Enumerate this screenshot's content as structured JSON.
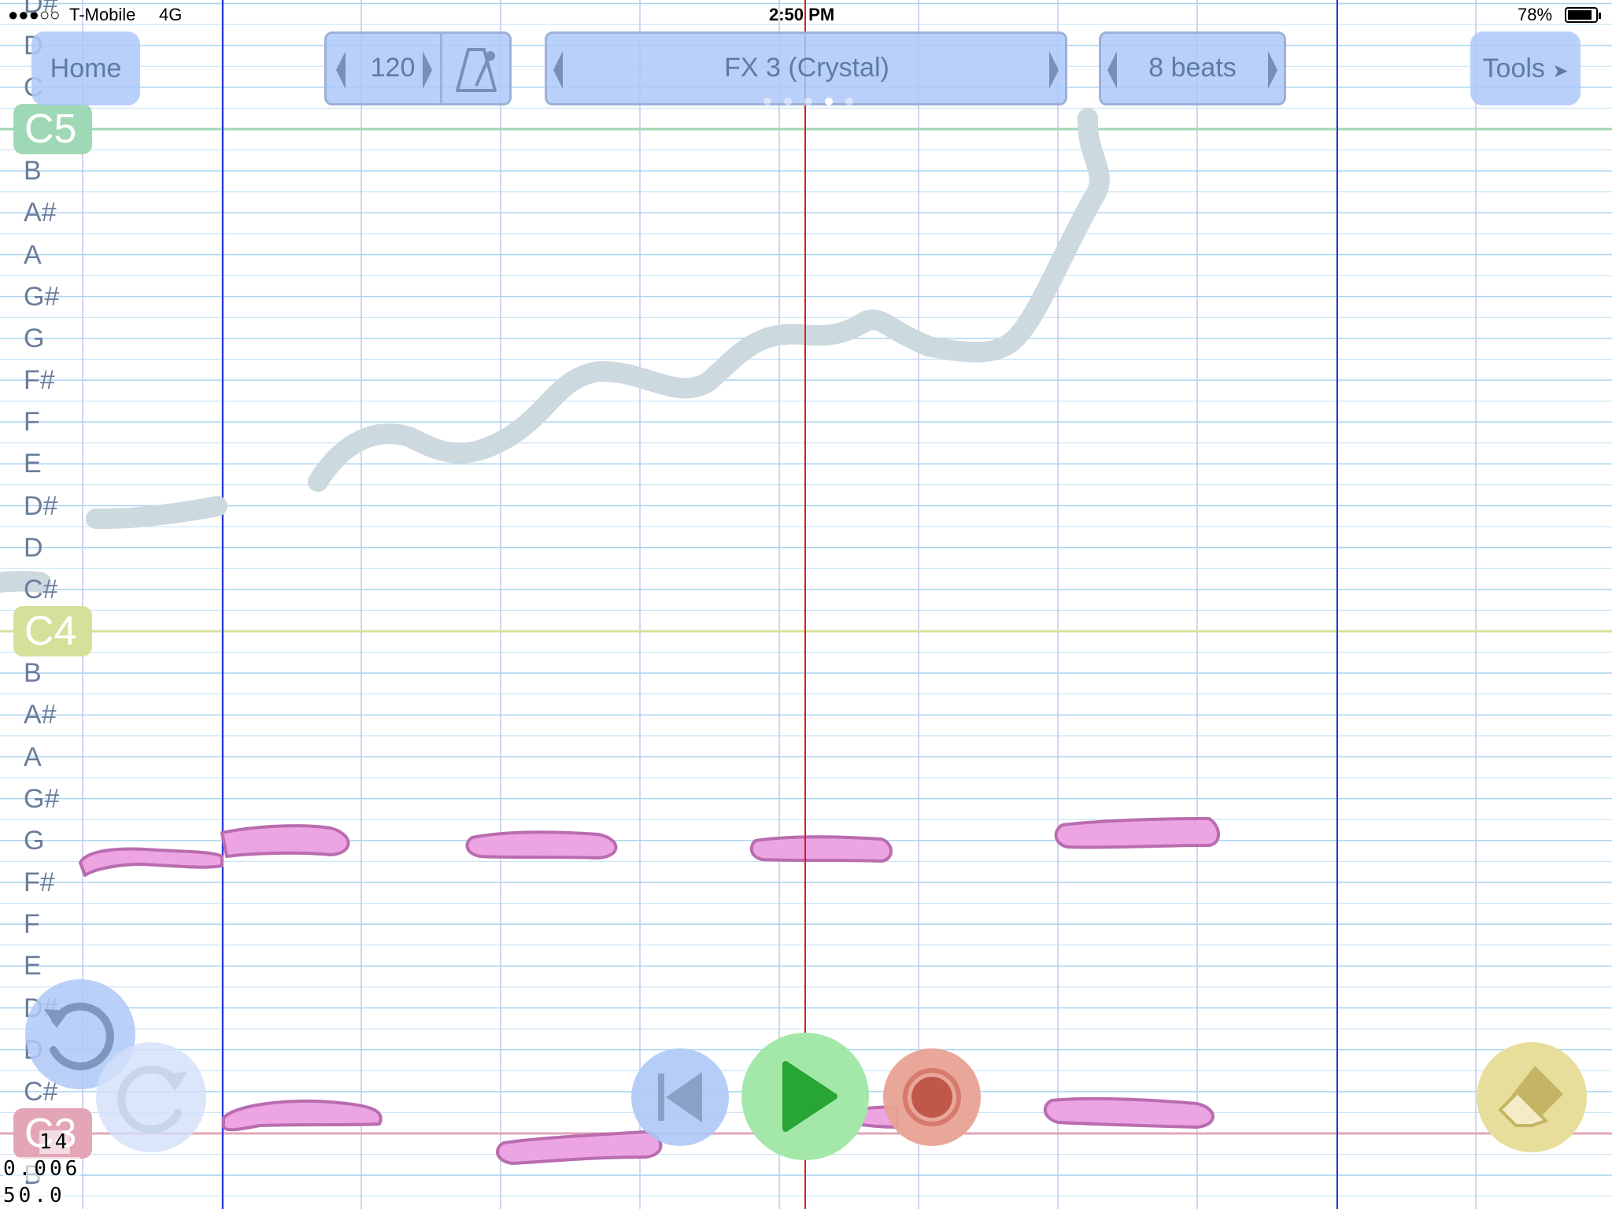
{
  "status_bar": {
    "signal": "●●●○○",
    "carrier": "T-Mobile",
    "network": "4G",
    "time": "2:50 PM",
    "battery": "78%"
  },
  "toolbar": {
    "home_label": "Home",
    "tempo_value": "120",
    "instrument_label": "FX 3 (Crystal)",
    "instrument_page_dots": 5,
    "instrument_page_active": 4,
    "length_label": "8 beats",
    "tools_label": "Tools",
    "tools_arrow": "➤"
  },
  "piano_labels": {
    "top_partial": [
      "D#",
      "D",
      "C"
    ],
    "c5": "C5",
    "upper": [
      "B",
      "A#",
      "A",
      "G#",
      "G",
      "F#",
      "F",
      "E",
      "D#",
      "D",
      "C#"
    ],
    "c4": "C4",
    "lower": [
      "B",
      "A#",
      "A",
      "G#",
      "G",
      "F#",
      "F",
      "E",
      "D#",
      "D",
      "C#"
    ],
    "c3": "C3",
    "below_c3": "B"
  },
  "debug_overlay": {
    "line1": "14",
    "line2": "0.006",
    "line3": "50.0"
  },
  "controls": {
    "undo": "undo-icon",
    "redo": "redo-icon",
    "rewind": "skip-back-icon",
    "play": "play-icon",
    "record": "record-icon",
    "eraser": "eraser-icon"
  },
  "colors": {
    "grid_line": "#a8d4f0",
    "beat_line": "#c4c8ea",
    "bar_line": "#2438d8",
    "playhead": "#d81e1e",
    "c5_line": "#9fd8b4",
    "c4_line": "#d7e09a",
    "c3_line": "#e2a6b6",
    "grey_stroke": "#ccd9df",
    "pink_note_fill": "#eca4e2",
    "pink_note_border": "#b96cb0",
    "control_blue": "#aec8f7",
    "play_green": "#a3e8a8",
    "play_icon": "#27a636",
    "record_red": "#e8a294",
    "record_icon": "#c0584a",
    "eraser_yellow": "#e8de9c",
    "eraser_icon": "#c6b465"
  }
}
